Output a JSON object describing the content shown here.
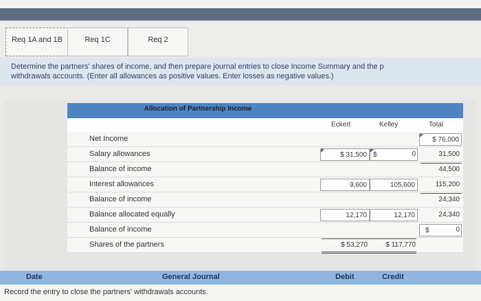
{
  "tabs": [
    {
      "label": "Req 1A and 1B"
    },
    {
      "label": "Req 1C"
    },
    {
      "label": "Req 2"
    }
  ],
  "instructions": {
    "line1": "Determine the partners' shares of income, and then prepare journal entries to close Income Summary and the p",
    "line2": "withdrawals accounts. (Enter all allowances as positive values. Enter losses as negative values.)"
  },
  "table": {
    "title": "Allocation of Partnership Income",
    "columns": {
      "eckert": "Eckert",
      "kelley": "Kelley",
      "total": "Total"
    },
    "rows": [
      {
        "label": "Net Income",
        "eckert": "",
        "kelley": "",
        "total": "$ 76,000"
      },
      {
        "label": "Salary allowances",
        "eckert": "$ 31,500",
        "kelley_prefix": "$",
        "kelley": "0",
        "total": "31,500"
      },
      {
        "label": "Balance of income",
        "eckert": "",
        "kelley": "",
        "total": "44,500"
      },
      {
        "label": "Interest allowances",
        "eckert": "9,600",
        "kelley": "105,600",
        "total": "115,200"
      },
      {
        "label": "Balance of income",
        "eckert": "",
        "kelley": "",
        "total": "24,340"
      },
      {
        "label": "Balance allocated equally",
        "eckert": "12,170",
        "kelley": "12,170",
        "total": "24,340"
      },
      {
        "label": "Balance of income",
        "eckert": "",
        "kelley": "",
        "total_prefix": "$",
        "total": "0"
      },
      {
        "label": "Shares of the partners",
        "eckert": "$ 53,270",
        "kelley": "$ 117,770",
        "total": ""
      }
    ]
  },
  "journal": {
    "col_date": "Date",
    "col_general": "General Journal",
    "col_debit": "Debit",
    "col_credit": "Credit",
    "instruction": "Record the entry to close the partners' withdrawals accounts."
  }
}
